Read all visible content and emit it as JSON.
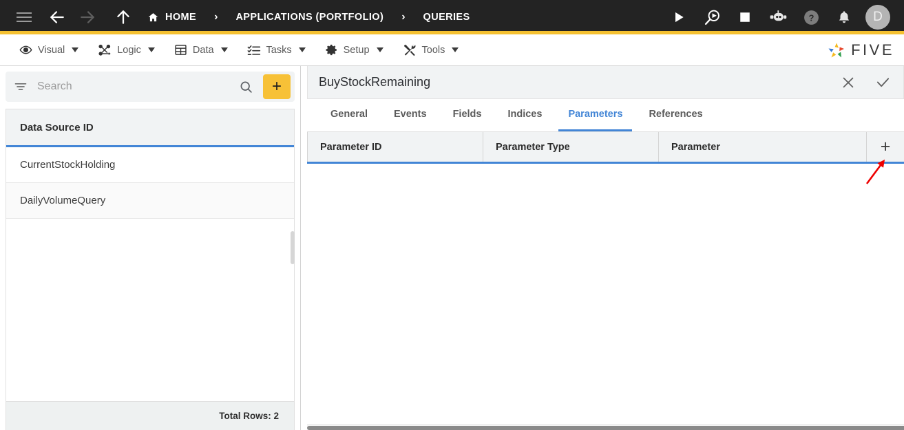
{
  "topbar": {
    "menu_icon": "hamburger-icon",
    "back_icon": "arrow-left-icon",
    "forward_icon": "arrow-right-icon",
    "up_icon": "arrow-up-icon",
    "breadcrumbs": [
      {
        "label": "HOME",
        "icon": "home-icon"
      },
      {
        "label": "APPLICATIONS (PORTFOLIO)",
        "icon": ""
      },
      {
        "label": "QUERIES",
        "icon": ""
      }
    ],
    "separator": "›",
    "actions": [
      {
        "name": "run-button",
        "icon": "play-icon"
      },
      {
        "name": "debug-button",
        "icon": "search-play-icon"
      },
      {
        "name": "stop-button",
        "icon": "stop-square-icon"
      },
      {
        "name": "assistant-button",
        "icon": "robot-icon"
      },
      {
        "name": "help-button",
        "icon": "question-circle-icon"
      },
      {
        "name": "notifications-button",
        "icon": "bell-icon"
      }
    ],
    "avatar_initial": "D",
    "accent_color": "#F5C131",
    "background_color": "#232323"
  },
  "menubar": {
    "items": [
      {
        "label": "Visual",
        "icon": "eye-icon"
      },
      {
        "label": "Logic",
        "icon": "node-graph-icon"
      },
      {
        "label": "Data",
        "icon": "table-grid-icon"
      },
      {
        "label": "Tasks",
        "icon": "task-list-icon"
      },
      {
        "label": "Setup",
        "icon": "gear-icon"
      },
      {
        "label": "Tools",
        "icon": "tools-icon"
      }
    ],
    "brand": "FIVE"
  },
  "sidebar": {
    "search": {
      "placeholder": "Search",
      "value": "",
      "filter_icon": "filter-icon",
      "search_icon": "magnifier-icon",
      "add_label": "+"
    },
    "list": {
      "header": "Data Source ID",
      "rows": [
        {
          "label": "CurrentStockHolding"
        },
        {
          "label": "DailyVolumeQuery"
        }
      ],
      "footer": "Total Rows: 2"
    }
  },
  "main": {
    "title": "BuyStockRemaining",
    "close_icon": "close-icon",
    "confirm_icon": "check-icon",
    "tabs": [
      {
        "label": "General",
        "active": false
      },
      {
        "label": "Events",
        "active": false
      },
      {
        "label": "Fields",
        "active": false
      },
      {
        "label": "Indices",
        "active": false
      },
      {
        "label": "Parameters",
        "active": true
      },
      {
        "label": "References",
        "active": false
      }
    ],
    "table": {
      "columns": [
        "Parameter ID",
        "Parameter Type",
        "Parameter"
      ],
      "add_label": "+",
      "rows": []
    },
    "accent_color": "#4285d6"
  },
  "annotation": {
    "arrow_color": "#ee0000",
    "points_to": "add-parameter-button"
  }
}
